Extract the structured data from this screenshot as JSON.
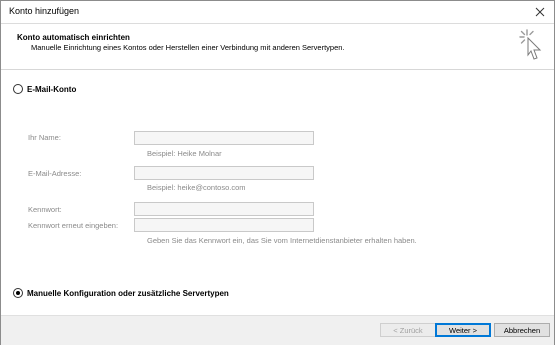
{
  "window": {
    "title": "Konto hinzufügen"
  },
  "header": {
    "title": "Konto automatisch einrichten",
    "subtitle": "Manuelle Einrichtung eines Kontos oder Herstellen einer Verbindung mit anderen Servertypen."
  },
  "options": {
    "email_account": {
      "label": "E-Mail-Konto",
      "selected": false
    },
    "manual_config": {
      "label": "Manuelle Konfiguration oder zusätzliche Servertypen",
      "selected": true
    }
  },
  "fields": {
    "name": {
      "label": "Ihr Name:",
      "value": "",
      "hint": "Beispiel: Heike Molnar"
    },
    "email": {
      "label": "E-Mail-Adresse:",
      "value": "",
      "hint": "Beispiel: heike@contoso.com"
    },
    "password": {
      "label": "Kennwort:",
      "value": ""
    },
    "password_repeat": {
      "label": "Kennwort erneut eingeben:",
      "value": "",
      "hint": "Geben Sie das Kennwort ein, das Sie vom Internetdienstanbieter erhalten haben."
    }
  },
  "buttons": {
    "back": "< Zurück",
    "next": "Weiter >",
    "cancel": "Abbrechen"
  },
  "icons": {
    "close": "close-icon",
    "wizard": "wizard-cursor-icon"
  }
}
